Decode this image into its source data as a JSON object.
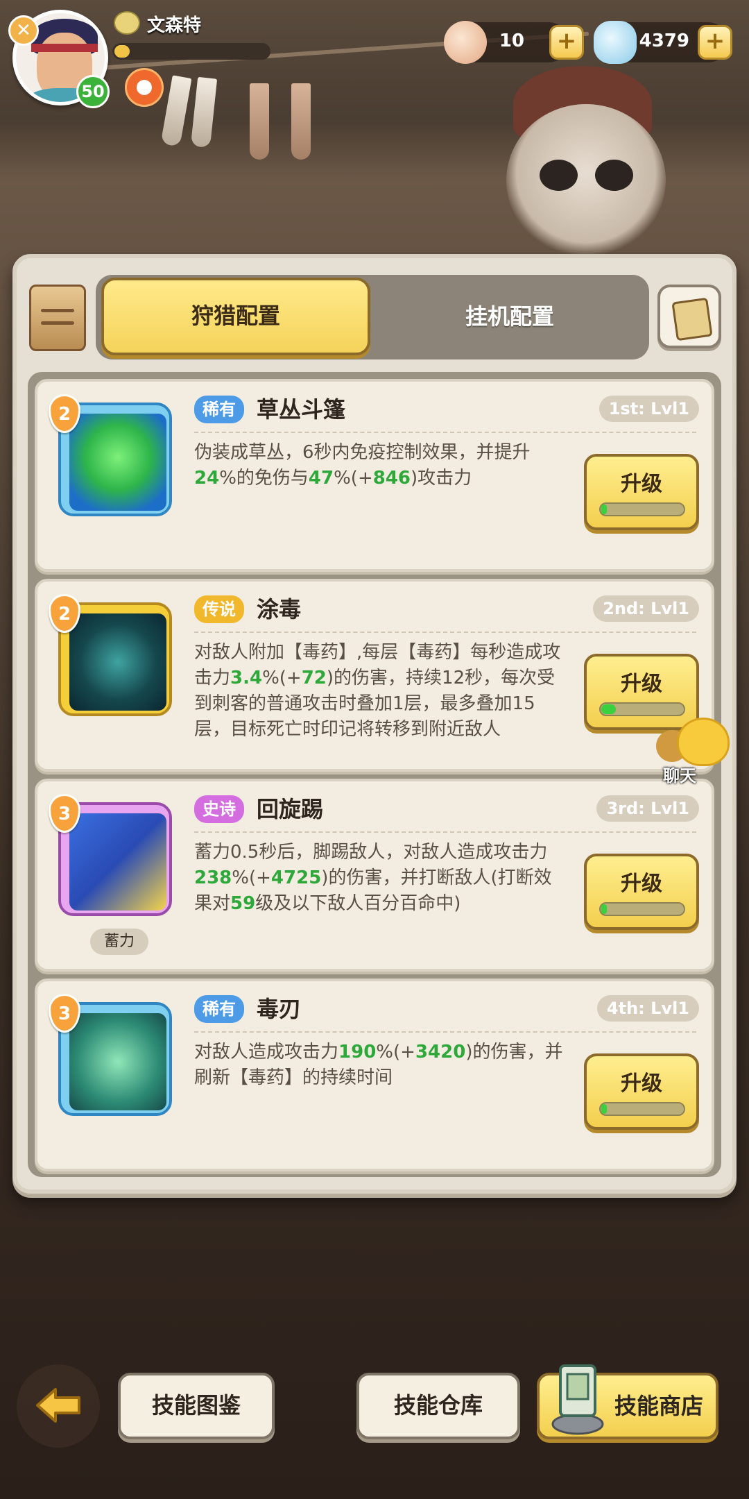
{
  "player": {
    "name": "文森特",
    "level": "50",
    "xp_fraction": 0.1
  },
  "currency": {
    "shell": "10",
    "gem": "4379"
  },
  "tabs": {
    "active": "狩猎配置",
    "inactive": "挂机配置"
  },
  "skills": [
    {
      "rank": "2",
      "rarity": "稀有",
      "rarity_color": "#4d9be6",
      "name": "草丛斗篷",
      "slot": "1st: Lvl1",
      "desc_parts": [
        {
          "t": "伪装成草丛，6秒内免疫控制效果，并提升"
        },
        {
          "t": "24",
          "g": true
        },
        {
          "t": "%的免伤与"
        },
        {
          "t": "47",
          "g": true
        },
        {
          "t": "%(+"
        },
        {
          "t": "846",
          "g": true
        },
        {
          "t": ")攻击力"
        }
      ],
      "upgrade_label": "升级",
      "progress": 0.05,
      "frame_color": "#7fd0f0",
      "icon": "bush-cloak-icon"
    },
    {
      "rank": "2",
      "rarity": "传说",
      "rarity_color": "#f0b82a",
      "name": "涂毒",
      "slot": "2nd: Lvl1",
      "desc_parts": [
        {
          "t": "对敌人附加【毒药】,每层【毒药】每秒造成攻击力"
        },
        {
          "t": "3.4",
          "g": true
        },
        {
          "t": "%(+"
        },
        {
          "t": "72",
          "g": true
        },
        {
          "t": ")的伤害，持续12秒，每次受到刺客的普通攻击时叠加1层，最多叠加15层，目标死亡时印记将转移到附近敌人"
        }
      ],
      "upgrade_label": "升级",
      "progress": 0.18,
      "frame_color": "#f5cf3a",
      "icon": "poison-drop-icon"
    },
    {
      "rank": "3",
      "rarity": "史诗",
      "rarity_color": "#d46ee0",
      "name": "回旋踢",
      "slot": "3rd: Lvl1",
      "desc_parts": [
        {
          "t": "蓄力0.5秒后，脚踢敌人，对敌人造成攻击力"
        },
        {
          "t": "238",
          "g": true
        },
        {
          "t": "%(+"
        },
        {
          "t": "4725",
          "g": true
        },
        {
          "t": ")的伤害，并打断敌人(打断效果对"
        },
        {
          "t": "59",
          "g": true
        },
        {
          "t": "级及以下敌人百分百命中)"
        }
      ],
      "upgrade_label": "升级",
      "progress": 0.04,
      "frame_color": "#e8a6f0",
      "icon": "spin-kick-icon",
      "tag": "蓄力"
    },
    {
      "rank": "3",
      "rarity": "稀有",
      "rarity_color": "#4d9be6",
      "name": "毒刃",
      "slot": "4th: Lvl1",
      "desc_parts": [
        {
          "t": "对敌人造成攻击力"
        },
        {
          "t": "190",
          "g": true
        },
        {
          "t": "%(+"
        },
        {
          "t": "3420",
          "g": true
        },
        {
          "t": ")的伤害，并刷新【毒药】的持续时间"
        }
      ],
      "upgrade_label": "升级",
      "progress": 0.04,
      "frame_color": "#7fd0f0",
      "icon": "poison-skull-icon"
    }
  ],
  "chat": {
    "label": "聊天"
  },
  "bottom": {
    "codex": "技能图鉴",
    "storage": "技能仓库",
    "shop": "技能商店"
  }
}
